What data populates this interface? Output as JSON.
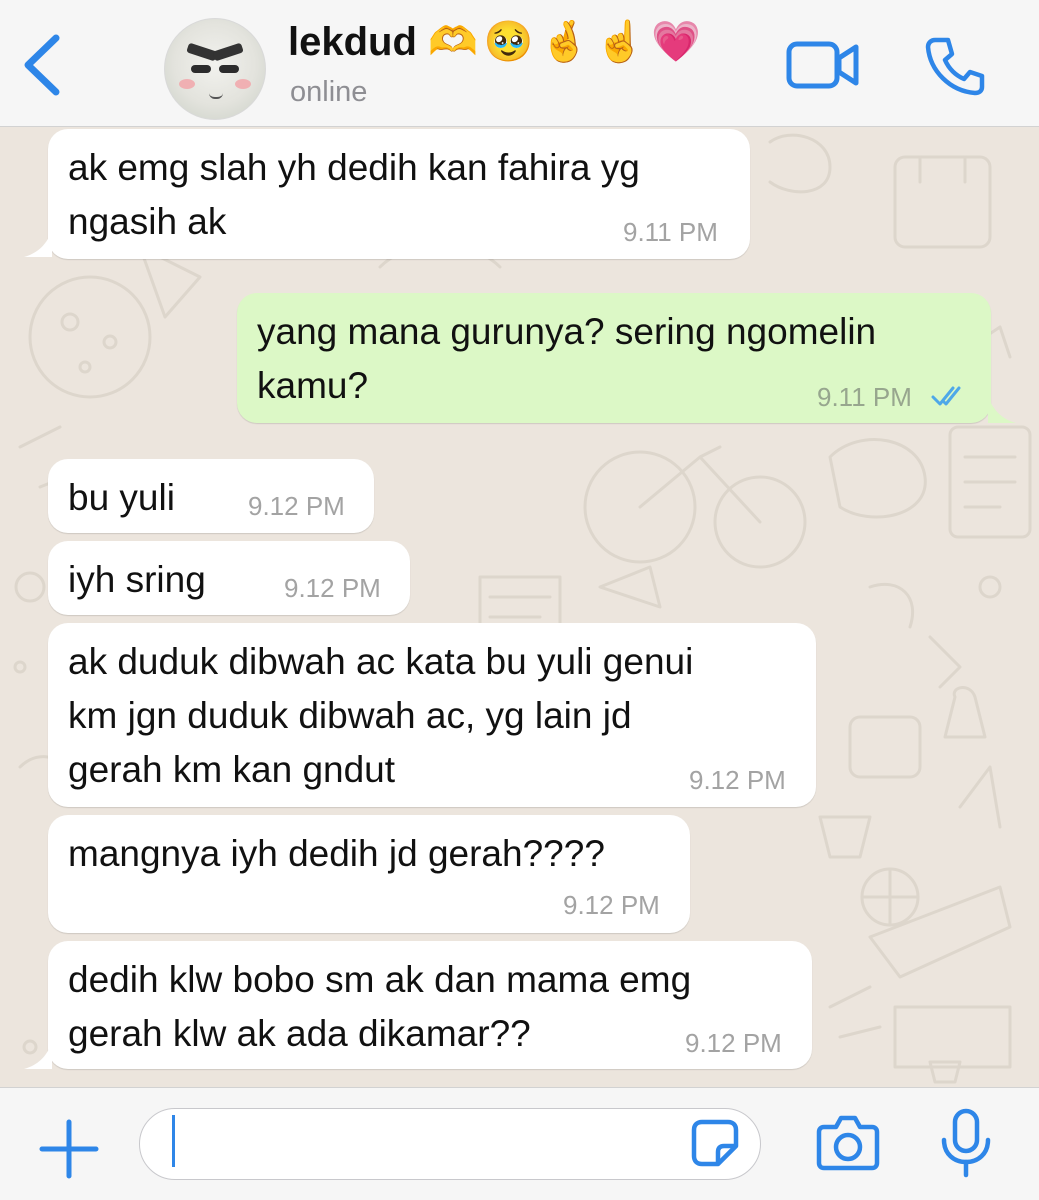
{
  "header": {
    "contact_name": "lekdud",
    "contact_emoji": "🫶🥹🤞☝️💗",
    "status": "online"
  },
  "messages": [
    {
      "direction": "incoming",
      "lines": [
        "ak emg slah yh dedih kan fahira yg",
        "ngasih ak"
      ],
      "time": "9.11 PM"
    },
    {
      "direction": "outgoing",
      "lines": [
        "yang mana gurunya? sering ngomelin",
        "kamu?"
      ],
      "time": "9.11 PM",
      "read": true
    },
    {
      "direction": "incoming",
      "lines": [
        "bu yuli"
      ],
      "time": "9.12 PM"
    },
    {
      "direction": "incoming",
      "lines": [
        "iyh sring"
      ],
      "time": "9.12 PM"
    },
    {
      "direction": "incoming",
      "lines": [
        "ak duduk dibwah ac kata bu yuli genui",
        "km jgn duduk dibwah ac, yg lain jd",
        "gerah km kan gndut"
      ],
      "time": "9.12 PM"
    },
    {
      "direction": "incoming",
      "lines": [
        "mangnya iyh dedih jd gerah????"
      ],
      "time": "9.12 PM"
    },
    {
      "direction": "incoming",
      "lines": [
        "dedih klw bobo sm ak dan mama emg",
        "gerah klw ak ada dikamar??"
      ],
      "time": "9.12 PM"
    }
  ],
  "composer": {
    "value": "",
    "placeholder": ""
  },
  "colors": {
    "accent": "#2E86E8",
    "incoming_bubble": "#FFFFFF",
    "outgoing_bubble": "#DCF8C6",
    "read_tick": "#4FA8E8",
    "wallpaper": "#ECE5DD"
  },
  "icons": {
    "back": "chevron-left-icon",
    "video": "video-camera-icon",
    "call": "phone-icon",
    "plus": "plus-icon",
    "sticker": "sticker-icon",
    "camera": "camera-icon",
    "mic": "microphone-icon"
  }
}
